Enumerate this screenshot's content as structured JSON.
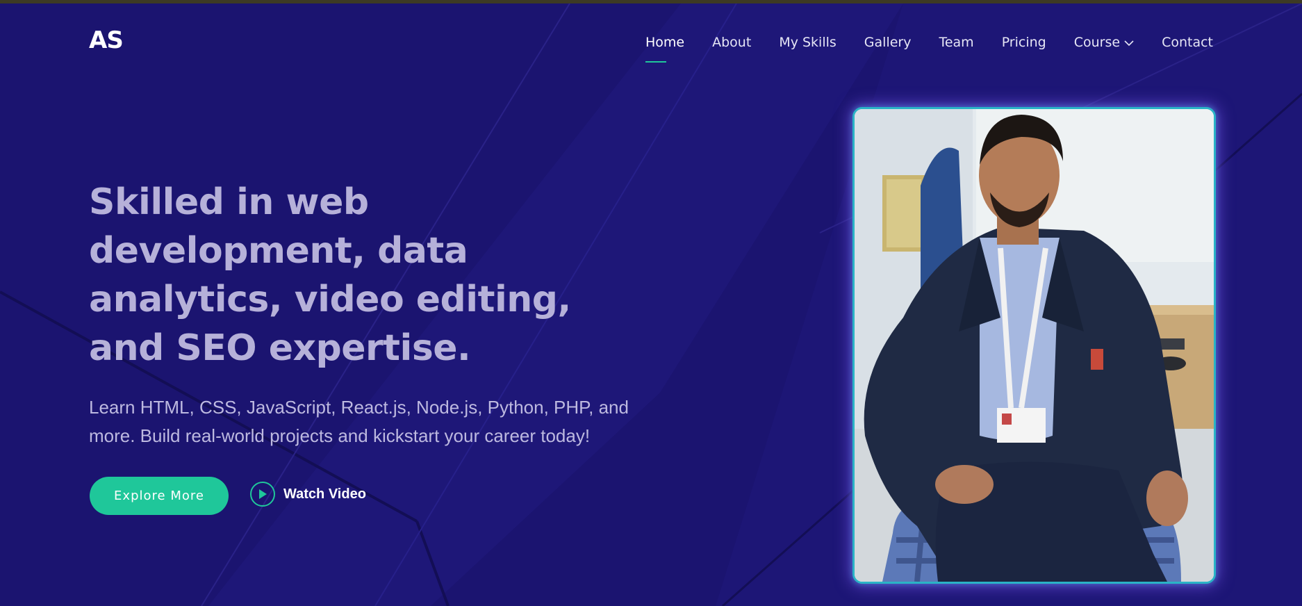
{
  "brand": {
    "logo_text": "AS"
  },
  "nav": {
    "items": [
      {
        "label": "Home",
        "active": true
      },
      {
        "label": "About"
      },
      {
        "label": "My Skills"
      },
      {
        "label": "Gallery"
      },
      {
        "label": "Team"
      },
      {
        "label": "Pricing"
      },
      {
        "label": "Course",
        "has_dropdown": true
      },
      {
        "label": "Contact"
      }
    ]
  },
  "hero": {
    "headline": "Skilled in web development, data analytics, video editing, and SEO expertise.",
    "subtext": "Learn HTML, CSS, JavaScript, React.js, Node.js, Python, PHP, and more. Build real-world projects and kickstart your career today!",
    "primary_button": "Explore More",
    "video_button": "Watch Video",
    "portrait_image": "person-in-navy-blazer-with-id-badge-portrait"
  },
  "icons": {
    "dropdown": "chevron-down-icon",
    "play": "play-icon"
  },
  "colors": {
    "background": "#1b1470",
    "accent": "#1fc79a",
    "headline": "#b6b1d9",
    "frame_border": "#2ab3c6"
  }
}
